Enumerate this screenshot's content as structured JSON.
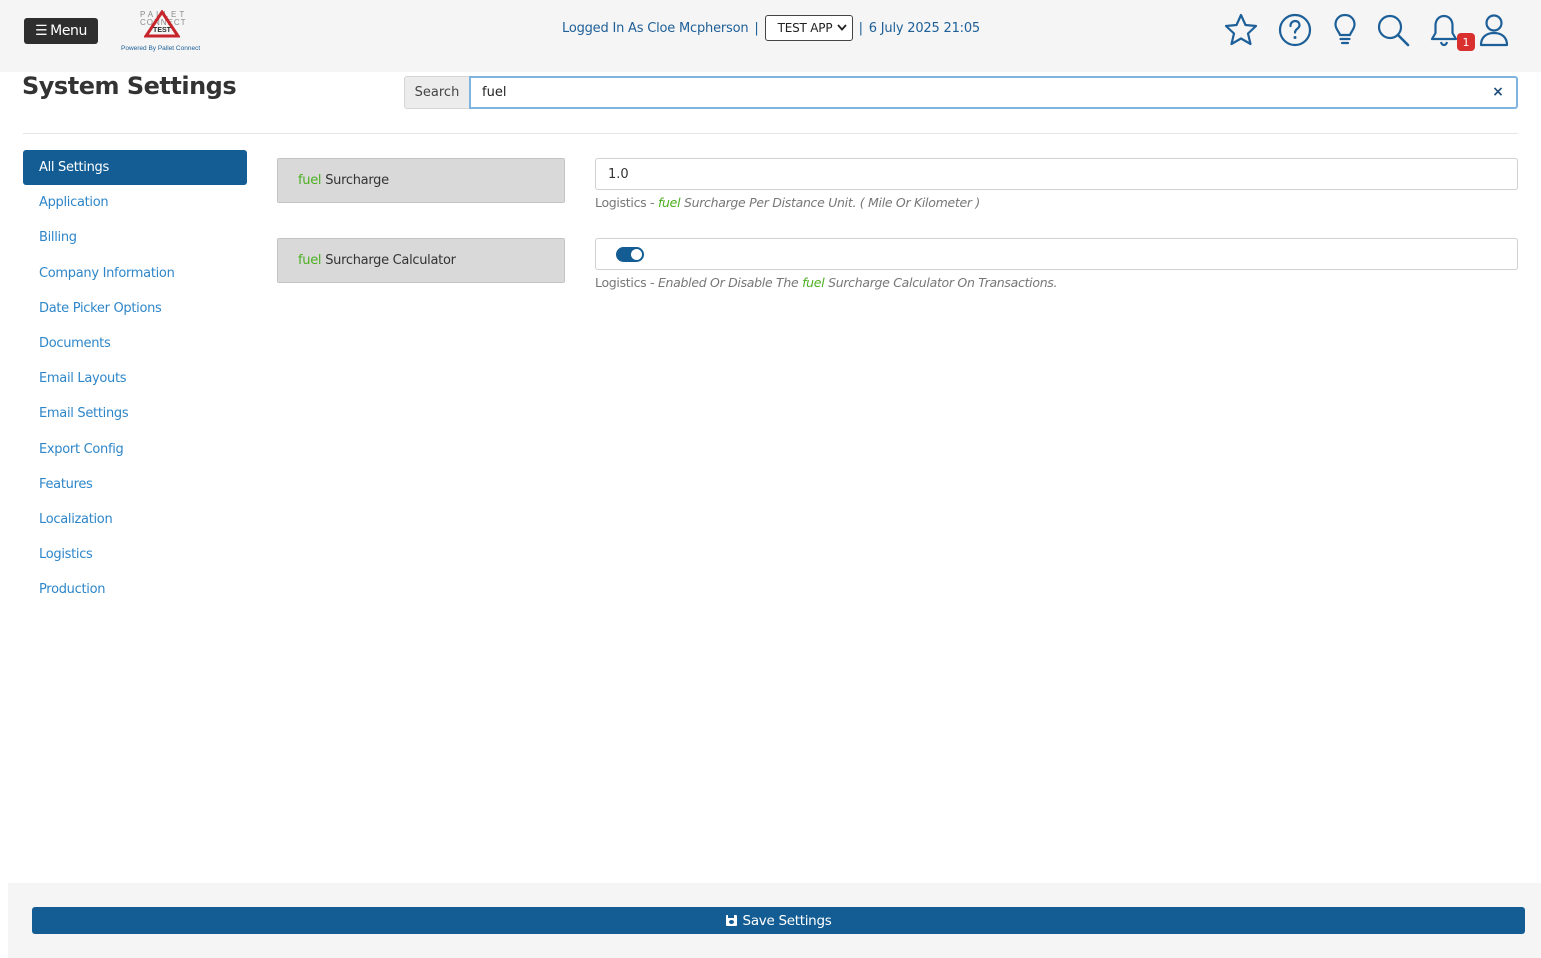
{
  "header": {
    "menu_label": "Menu",
    "logo": {
      "brand_top": "PALLET",
      "brand_mid": "CONNECT",
      "badge_text": "TEST",
      "powered_by": "Powered By Pallet Connect"
    },
    "logged_in_text": "Logged In As Cloe Mcpherson",
    "separator": "|",
    "app_selected": "TEST APP",
    "datetime": "6 July 2025 21:05",
    "notification_count": "1",
    "icons": [
      "star-icon",
      "help-icon",
      "lightbulb-icon",
      "search-icon",
      "bell-icon",
      "user-icon"
    ],
    "accent_color": "#1d5f98"
  },
  "page": {
    "title": "System Settings",
    "search_label": "Search",
    "search_value": "fuel",
    "clear_label": "×"
  },
  "sidebar": {
    "items": [
      {
        "label": "All Settings",
        "active": true
      },
      {
        "label": "Application"
      },
      {
        "label": "Billing"
      },
      {
        "label": "Company Information"
      },
      {
        "label": "Date Picker Options"
      },
      {
        "label": "Documents"
      },
      {
        "label": "Email Layouts"
      },
      {
        "label": "Email Settings"
      },
      {
        "label": "Export Config"
      },
      {
        "label": "Features"
      },
      {
        "label": "Localization"
      },
      {
        "label": "Logistics"
      },
      {
        "label": "Production"
      }
    ]
  },
  "settings": [
    {
      "label_highlight": "fuel",
      "label_rest": "Surcharge",
      "value": "1.0",
      "desc_category": "Logistics -",
      "desc_before": "",
      "desc_highlight": "fuel",
      "desc_after": "Surcharge Per Distance Unit.  ( Mile Or Kilometer )"
    },
    {
      "label_highlight": "fuel",
      "label_rest": "Surcharge Calculator",
      "toggle_on": true,
      "desc_category": "Logistics -",
      "desc_before": "Enabled Or Disable The",
      "desc_highlight": "fuel",
      "desc_after": "Surcharge Calculator On Transactions."
    }
  ],
  "footer": {
    "save_label": "Save Settings",
    "save_icon": "floppy-disk-icon",
    "button_color": "#135d94"
  }
}
